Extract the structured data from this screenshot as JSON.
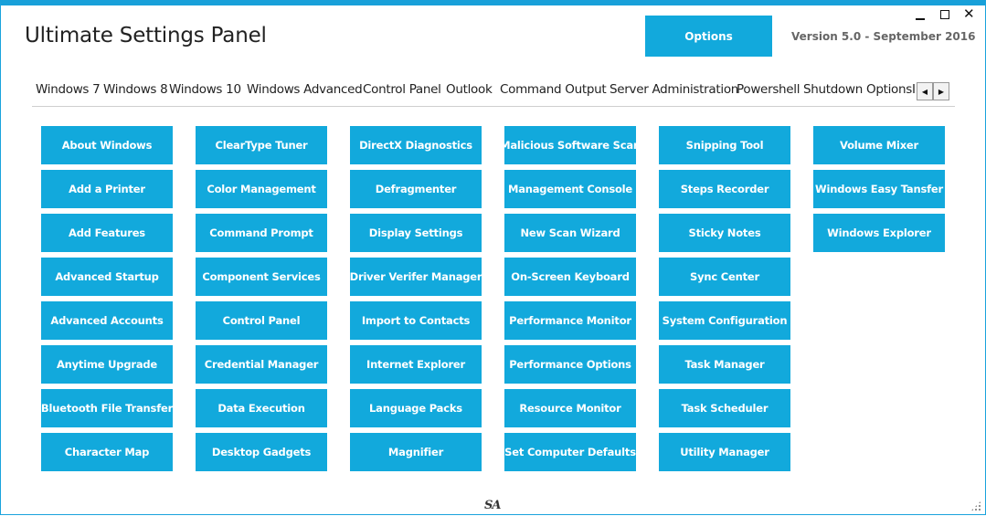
{
  "app": {
    "title": "Ultimate Settings Panel",
    "options_label": "Options",
    "version": "Version 5.0 - September 2016",
    "footer_logo": "SA"
  },
  "window_controls": {
    "minimize": "minimize-icon",
    "maximize": "maximize-icon",
    "close": "✕"
  },
  "tabs": [
    {
      "label": "Windows 7",
      "active": false
    },
    {
      "label": "Windows 8",
      "active": false
    },
    {
      "label": "Windows 10",
      "active": true
    },
    {
      "label": "Windows Advanced",
      "active": false
    },
    {
      "label": "Control Panel",
      "active": false
    },
    {
      "label": "Outlook",
      "active": false
    },
    {
      "label": "Command Output",
      "active": false
    },
    {
      "label": "Server Administration",
      "active": false
    },
    {
      "label": "Powershell",
      "active": false
    },
    {
      "label": "Shutdown Options",
      "active": false
    },
    {
      "label": "I",
      "active": false
    }
  ],
  "tab_scroll": {
    "left": "◀",
    "right": "▶"
  },
  "colors": {
    "accent": "#12a9dc",
    "border": "#18a0d9"
  },
  "buttons": [
    [
      "About Windows",
      "Add a Printer",
      "Add Features",
      "Advanced Startup",
      "Advanced Accounts",
      "Anytime Upgrade",
      "Bluetooth File Transfer",
      "Character Map"
    ],
    [
      "ClearType Tuner",
      "Color Management",
      "Command Prompt",
      "Component Services",
      "Control Panel",
      "Credential Manager",
      "Data Execution",
      "Desktop Gadgets"
    ],
    [
      "DirectX Diagnostics",
      "Defragmenter",
      "Display Settings",
      "Driver Verifer Manager",
      "Import to Contacts",
      "Internet Explorer",
      "Language Packs",
      "Magnifier"
    ],
    [
      "Malicious Software Scan",
      "Management Console",
      "New Scan Wizard",
      "On-Screen Keyboard",
      "Performance Monitor",
      "Performance Options",
      "Resource Monitor",
      "Set Computer Defaults"
    ],
    [
      "Snipping Tool",
      "Steps Recorder",
      "Sticky Notes",
      "Sync Center",
      "System Configuration",
      "Task Manager",
      "Task Scheduler",
      "Utility Manager"
    ],
    [
      "Volume Mixer",
      "Windows Easy Tansfer",
      "Windows Explorer"
    ]
  ]
}
